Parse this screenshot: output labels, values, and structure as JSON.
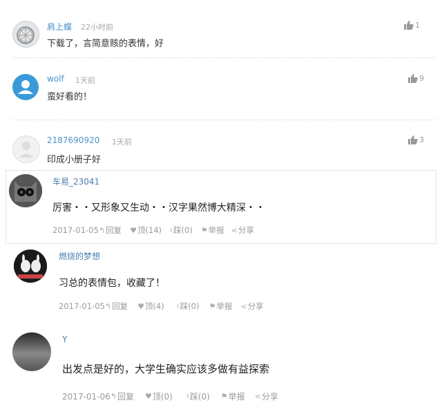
{
  "comments_top": [
    {
      "user": "肩上蝶",
      "time": "22小时前",
      "text": "下载了，言简意赅的表情，好",
      "likes": "1"
    },
    {
      "user": "wolf",
      "time": "1天前",
      "text": "蛮好看的！",
      "likes": "9"
    },
    {
      "user": "2187690920",
      "time": "1天前",
      "text": "印成小册子好",
      "likes": "3"
    }
  ],
  "comments_bottom": [
    {
      "user": "车易_23041",
      "text": "厉害・・又形象又生动・・汉字果然博大精深・・",
      "date": "2017-01-05",
      "reply": "回复",
      "up": "顶(14)",
      "down": "踩(0)",
      "report": "举报",
      "share": "分享"
    },
    {
      "user": "燃烧的梦想",
      "text": "习总的表情包，收藏了！",
      "date": "2017-01-05",
      "reply": "回复",
      "up": "顶(4)",
      "down": "踩(0)",
      "report": "举报",
      "share": "分享"
    },
    {
      "user": "Y",
      "text": "出发点是好的，大学生确实应该多做有益探索",
      "date": "2017-01-06",
      "reply": "回复",
      "up": "顶(0)",
      "down": "踩(0)",
      "report": "举报",
      "share": "分享"
    }
  ],
  "icons": {
    "thumb": "thumbs-up-icon",
    "reply": "reply-icon",
    "up": "heart-icon",
    "down": "thumbs-down-icon",
    "report": "flag-icon",
    "share": "share-icon"
  }
}
